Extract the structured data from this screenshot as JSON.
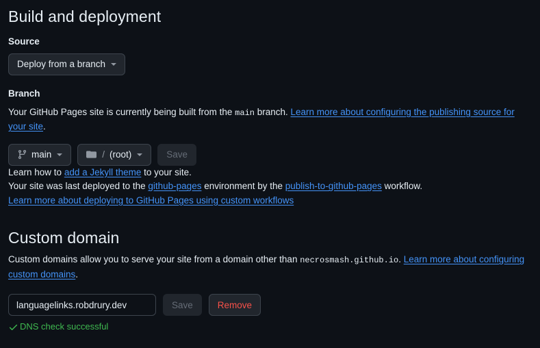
{
  "build_section": {
    "title": "Build and deployment",
    "source": {
      "label": "Source",
      "selected": "Deploy from a branch"
    },
    "branch": {
      "label": "Branch",
      "description_prefix": "Your GitHub Pages site is currently being built from the ",
      "branch_code": "main",
      "description_middle": " branch. ",
      "learn_more_link": "Learn more about configuring the publishing source for your site",
      "description_suffix": ".",
      "branch_button": "main",
      "path_slash": "/",
      "path_button": "(root)",
      "save_label": "Save"
    },
    "jekyll": {
      "prefix": "Learn how to ",
      "link": "add a Jekyll theme",
      "suffix": " to your site."
    },
    "deployment": {
      "prefix": "Your site was last deployed to the ",
      "environment_link": "github-pages",
      "middle": " environment by the ",
      "workflow_link": "publish-to-github-pages",
      "suffix": " workflow.",
      "custom_workflow_link": "Learn more about deploying to GitHub Pages using custom workflows"
    }
  },
  "custom_domain_section": {
    "title": "Custom domain",
    "description_prefix": "Custom domains allow you to serve your site from a domain other than ",
    "default_domain": "necrosmash.github.io",
    "description_middle": ". ",
    "learn_more_link": "Learn more about configuring custom domains",
    "description_suffix": ".",
    "input_value": "languagelinks.robdrury.dev",
    "input_placeholder": "example.com",
    "save_label": "Save",
    "remove_label": "Remove",
    "dns_status": "DNS check successful"
  },
  "colors": {
    "background": "#0d1117",
    "link": "#4493f8",
    "success": "#3fb950",
    "danger": "#f85149",
    "button_bg": "#21262d",
    "border": "#3d444d"
  }
}
